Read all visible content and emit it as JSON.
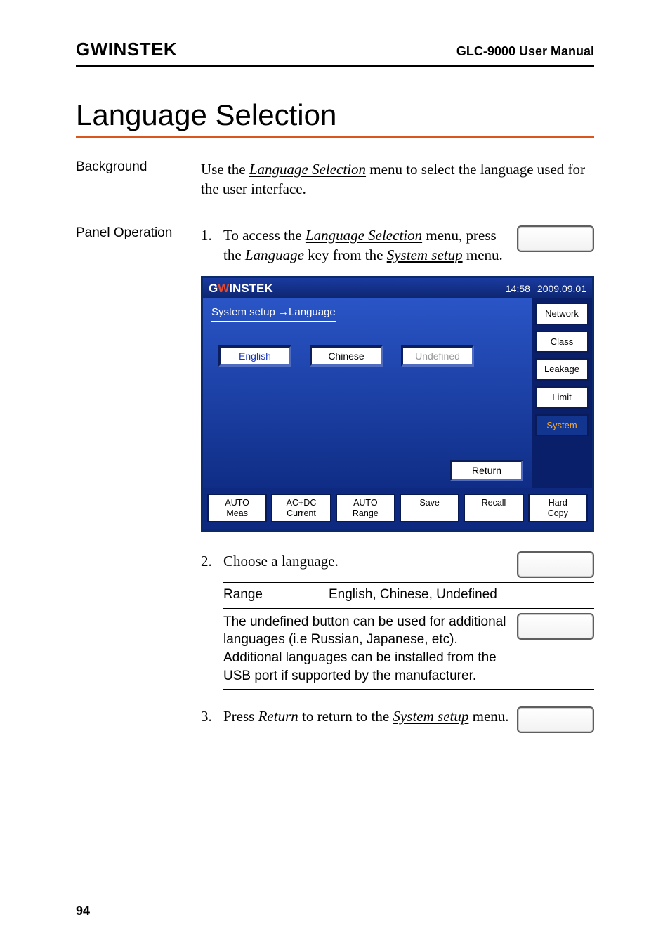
{
  "header": {
    "brand": "GWINSTEK",
    "manual": "GLC-9000 User Manual"
  },
  "title": "Language Selection",
  "background": {
    "label": "Background",
    "text_pre": "Use the ",
    "text_link": "Language Selection",
    "text_post": " menu to select the language used for the user interface."
  },
  "panel": {
    "label": "Panel Operation",
    "step1": {
      "num": "1.",
      "pre": "To access the ",
      "link1": "Language Selection",
      "mid": " menu, press the ",
      "it": "Language",
      "mid2": " key from the ",
      "link2": "System setup",
      "post": " menu."
    },
    "step2_num": "2.",
    "step2_text": "Choose a language.",
    "range_label": "Range",
    "range_value": "English, Chinese, Undefined",
    "note": "The undefined button can be used for additional languages (i.e Russian, Japanese, etc). Additional languages can be installed from the USB port if supported by the manufacturer.",
    "step3_num": "3.",
    "step3_pre": "Press ",
    "step3_it": "Return",
    "step3_mid": " to return to the ",
    "step3_link": "System setup",
    "step3_post": " menu."
  },
  "device": {
    "brand_a": "G",
    "brand_b": "W",
    "brand_c": "INSTEK",
    "time": "14:58",
    "date": "2009.09.01",
    "breadcrumb": "System setup →Language",
    "buttons": {
      "english": "English",
      "chinese": "Chinese",
      "undefined": "Undefined",
      "return": "Return"
    },
    "side": [
      "Network",
      "Class",
      "Leakage",
      "Limit",
      "System"
    ],
    "bottom": [
      {
        "l1": "AUTO",
        "l2": "Meas"
      },
      {
        "l1": "AC+DC",
        "l2": "Current"
      },
      {
        "l1": "AUTO",
        "l2": "Range"
      },
      {
        "l1": "Save",
        "l2": ""
      },
      {
        "l1": "Recall",
        "l2": ""
      },
      {
        "l1": "Hard",
        "l2": "Copy"
      }
    ]
  },
  "pagenum": "94"
}
